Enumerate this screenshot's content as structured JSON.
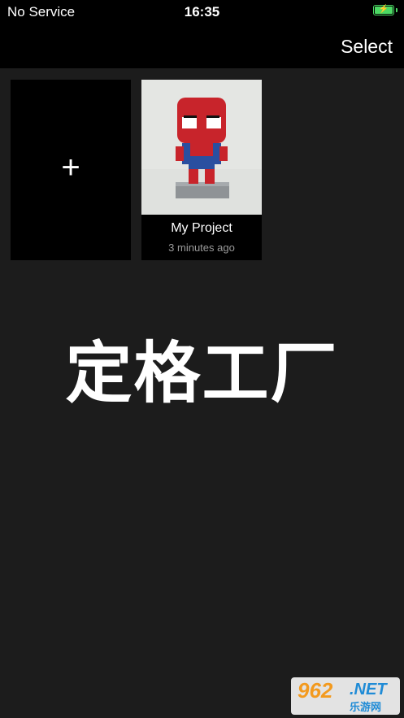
{
  "status_bar": {
    "carrier": "No Service",
    "time": "16:35",
    "battery_level": 1.0,
    "battery_color": "#4cd964",
    "battery_charging_icon": "bolt-icon"
  },
  "nav": {
    "select_label": "Select"
  },
  "new_project": {
    "icon": "plus-icon",
    "symbol": "+"
  },
  "projects": [
    {
      "name": "My Project",
      "time_ago": "3 minutes ago",
      "thumbnail": "lego-spiderman-figure-photo"
    }
  ],
  "overlay_title": "定格工厂",
  "watermark": {
    "number": "962",
    "domain": ".NET",
    "subtitle": "乐游网"
  }
}
